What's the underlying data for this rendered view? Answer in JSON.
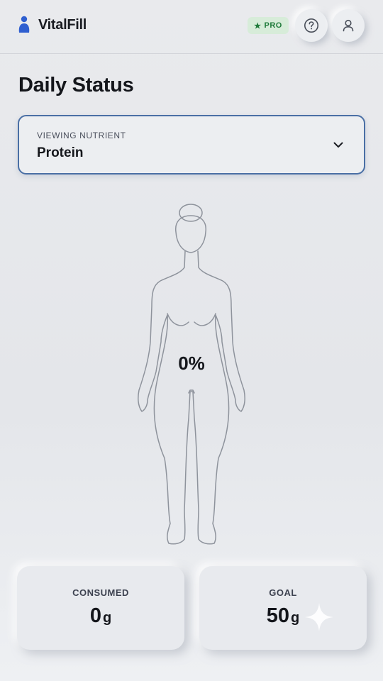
{
  "header": {
    "app_name": "VitalFill",
    "badge": "PRO",
    "icons": {
      "logo": "person-logo-icon",
      "badge": "star-icon",
      "help": "help-circle-icon",
      "user": "user-icon"
    },
    "accent_color": "#2f5fd0",
    "badge_bg": "#d7ecd9",
    "badge_text_color": "#1f7a3a"
  },
  "main": {
    "title": "Daily Status",
    "nutrient_selector": {
      "caption": "VIEWING NUTRIENT",
      "value": "Protein",
      "icon": "chevron-down-icon",
      "border_color": "#4a6fa5"
    },
    "body_fill": {
      "percent_text": "0%",
      "fill_fraction": 0
    },
    "stats": {
      "consumed": {
        "label": "CONSUMED",
        "value": "0",
        "unit": "g"
      },
      "goal": {
        "label": "GOAL",
        "value": "50",
        "unit": "g"
      }
    },
    "decor_icon": "sparkle-icon"
  }
}
